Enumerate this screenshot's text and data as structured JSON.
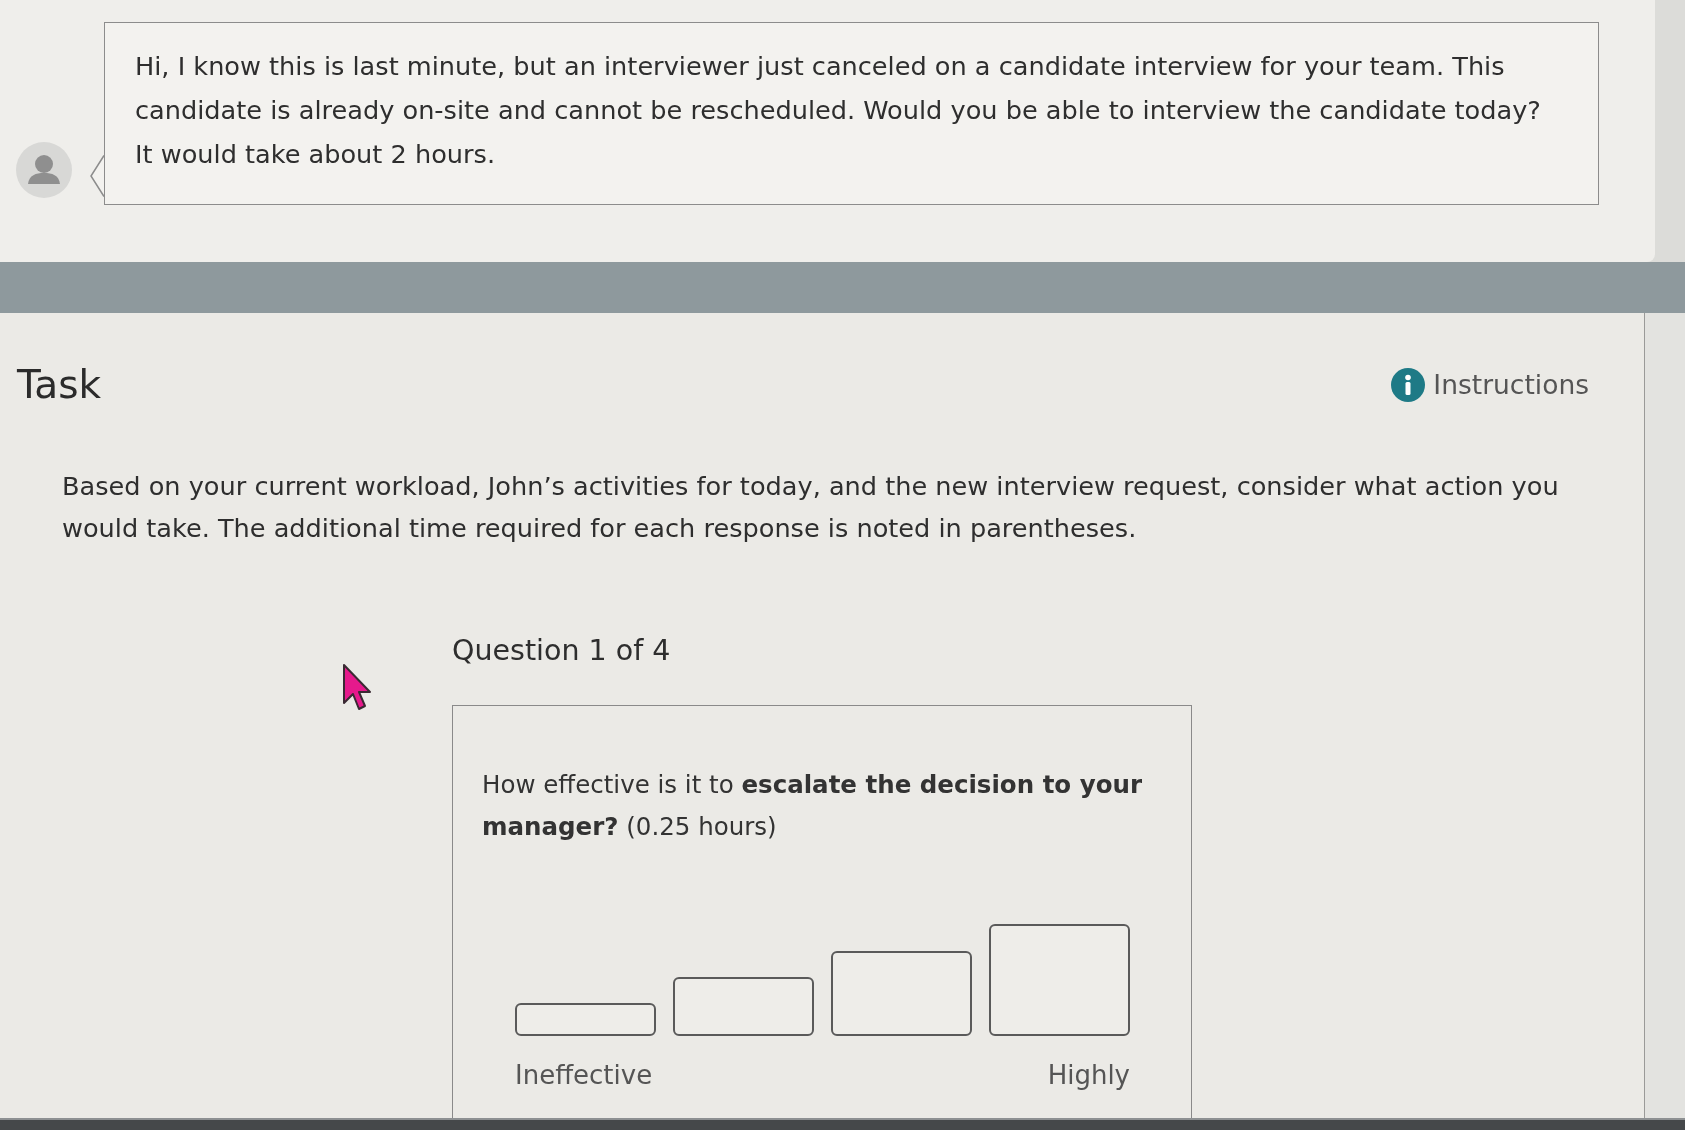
{
  "message": {
    "text": "Hi, I know this is last minute, but an interviewer just canceled on a candidate interview for your team. This candidate is already on-site and cannot be rescheduled. Would you be able to interview the candidate today? It would take about 2 hours."
  },
  "task": {
    "title": "Task",
    "instructions_link": "Instructions",
    "description": "Based on your current workload, John’s activities for today, and the new interview request, consider what action you would take. The additional time required for each response is noted in parentheses."
  },
  "question": {
    "counter": "Question 1 of 4",
    "prompt": "How effective is it to **escalate the decision to your manager?** (0.25 hours)",
    "options": [
      {
        "selected": false
      },
      {
        "selected": false
      },
      {
        "selected": false
      },
      {
        "selected": false
      }
    ],
    "low_label": "Ineffective",
    "high_label": "Highly"
  }
}
